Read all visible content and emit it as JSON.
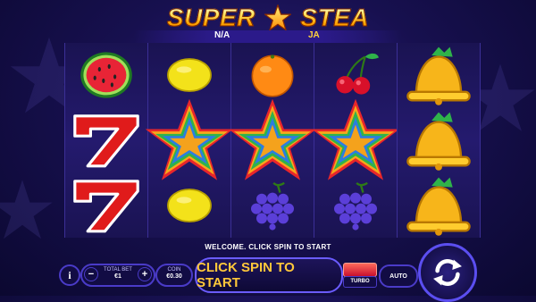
{
  "game": {
    "title_left": "SUPER",
    "title_right": "STEA",
    "header_left_value": "N/A",
    "header_right_value": "JA"
  },
  "reels": [
    [
      "watermelon",
      "seven",
      "seven"
    ],
    [
      "lemon",
      "rainbow-star",
      "lemon"
    ],
    [
      "orange",
      "rainbow-star",
      "grapes"
    ],
    [
      "cherries",
      "rainbow-star",
      "grapes"
    ],
    [
      "bell",
      "bell",
      "bell"
    ]
  ],
  "message": "WELCOME. CLICK SPIN TO START",
  "controls": {
    "info_label": "i",
    "minus_label": "−",
    "plus_label": "+",
    "total_bet_label": "TOTAL BET",
    "total_bet_value": "€1",
    "coin_label": "COIN",
    "coin_value": "€0.30",
    "spin_text": "CLICK SPIN TO START",
    "turbo_label": "TURBO",
    "auto_label": "AUTO"
  },
  "colors": {
    "accent_gold": "#ffc83a",
    "border_blue": "#4a3bc8",
    "background": "#17104f"
  }
}
